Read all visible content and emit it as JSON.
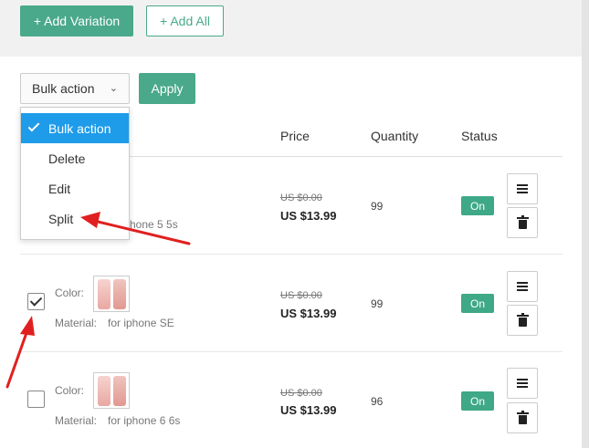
{
  "toolbar": {
    "add_variation_label": "+ Add Variation",
    "add_all_label": "+ Add All"
  },
  "bulk": {
    "select_value": "Bulk action",
    "apply_label": "Apply"
  },
  "dropdown": {
    "items": [
      "Bulk action",
      "Delete",
      "Edit",
      "Split"
    ],
    "selected": "Bulk action"
  },
  "table": {
    "columns": [
      "Price",
      "Quantity",
      "Status"
    ],
    "rows": [
      {
        "color_label": "",
        "material_label": "",
        "material_value": "hone 5 5s",
        "old_price": "US $0.00",
        "price": "US $13.99",
        "quantity": "99",
        "status": "On",
        "checked": false
      },
      {
        "color_label": "Color:",
        "material_label": "Material:",
        "material_value": "for iphone SE",
        "old_price": "US $0.00",
        "price": "US $13.99",
        "quantity": "99",
        "status": "On",
        "checked": true
      },
      {
        "color_label": "Color:",
        "material_label": "Material:",
        "material_value": "for iphone 6 6s",
        "old_price": "US $0.00",
        "price": "US $13.99",
        "quantity": "96",
        "status": "On",
        "checked": false
      }
    ]
  },
  "colors": {
    "accent": "#4aa98a",
    "dropdown_highlight": "#1e9be9",
    "annotation_arrow": "#e02020"
  }
}
